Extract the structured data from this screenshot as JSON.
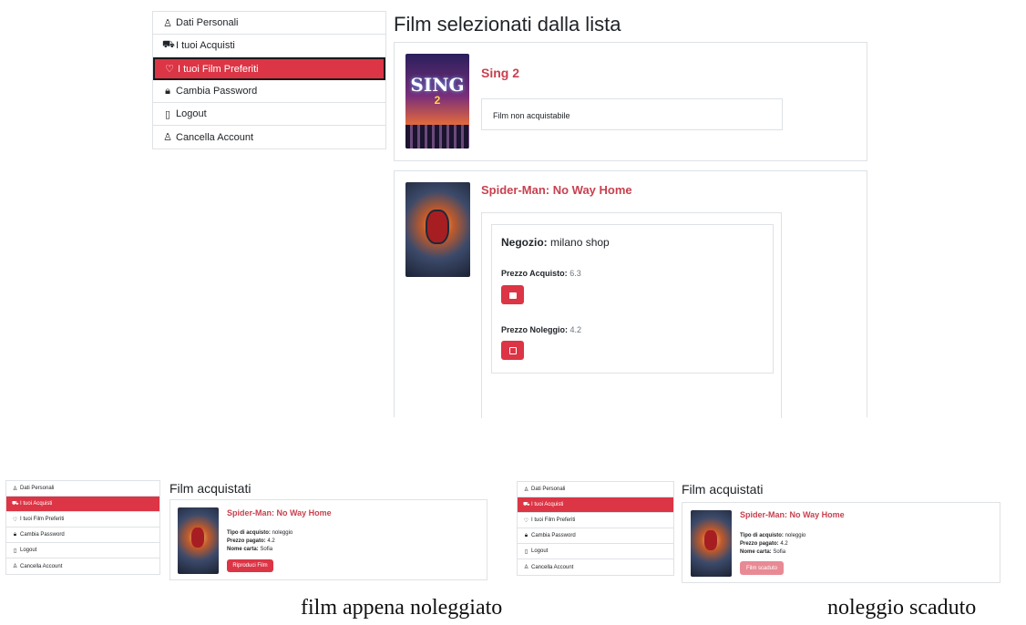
{
  "menu": {
    "items": [
      {
        "icon": "user-icon",
        "glyph": "♙",
        "label": "Dati Personali",
        "active": false
      },
      {
        "icon": "cart-icon",
        "glyph": "⛟",
        "label": "I tuoi Acquisti",
        "active": false
      },
      {
        "icon": "heart-icon",
        "glyph": "♡",
        "label": "I tuoi Film Preferiti",
        "active": true
      },
      {
        "icon": "lock-icon",
        "glyph": "🔒︎",
        "label": "Cambia Password",
        "active": false
      },
      {
        "icon": "door-icon",
        "glyph": "▯",
        "label": "Logout",
        "active": false
      },
      {
        "icon": "user-remove-icon",
        "glyph": "♙",
        "label": "Cancella Account",
        "active": false
      }
    ]
  },
  "favorites": {
    "title": "Film selezionati dalla lista",
    "films": [
      {
        "title": "Sing 2",
        "poster_text": "SING",
        "poster_sub": "2",
        "status": "Film non acquistabile"
      },
      {
        "title": "Spider-Man: No Way Home",
        "shop_label": "Negozio:",
        "shop": "milano shop",
        "buy_label": "Prezzo Acquisto:",
        "buy_price": "6.3",
        "rent_label": "Prezzo Noleggio:",
        "rent_price": "4.2"
      }
    ]
  },
  "purchases_left": {
    "title": "Film acquistati",
    "film": "Spider-Man: No Way Home",
    "type_label": "Tipo di acquisto:",
    "type": "noleggio",
    "paid_label": "Prezzo pagato:",
    "paid": "4.2",
    "card_label": "Nome carta:",
    "card": "Sofia",
    "button": "Riproduci Film",
    "caption": "film appena noleggiato"
  },
  "purchases_right": {
    "title": "Film acquistati",
    "film": "Spider-Man: No Way Home",
    "type_label": "Tipo di acquisto:",
    "type": "noleggio",
    "paid_label": "Prezzo pagato:",
    "paid": "4.2",
    "card_label": "Nome carta:",
    "card": "Sofia",
    "button": "Film scaduto",
    "caption": "noleggio scaduto"
  },
  "colors": {
    "accent": "#dc3545",
    "title_red": "#c8414f",
    "border": "#dee2e6",
    "disabled": "#e88a94"
  }
}
